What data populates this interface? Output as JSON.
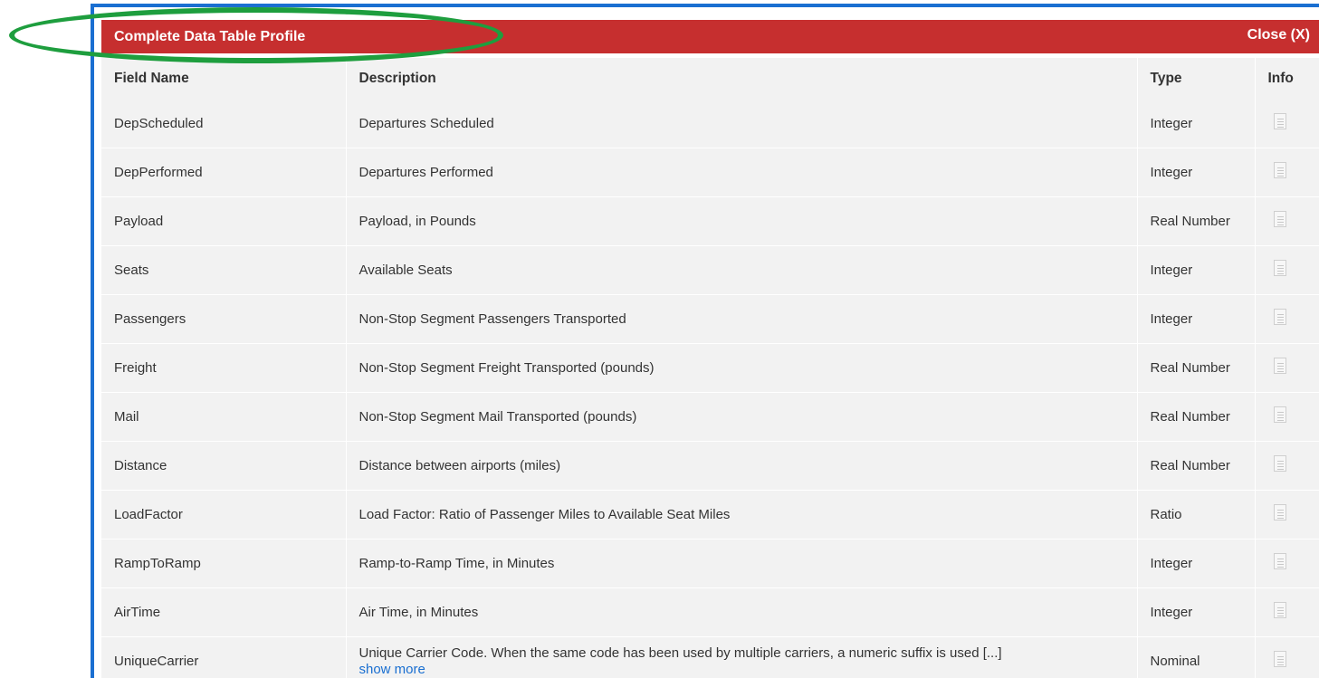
{
  "dialog": {
    "title": "Complete Data Table Profile",
    "close_label": "Close (X)"
  },
  "table": {
    "headers": {
      "field_name": "Field Name",
      "description": "Description",
      "type": "Type",
      "info": "Info"
    },
    "rows": [
      {
        "field": "DepScheduled",
        "description": "Departures Scheduled",
        "type": "Integer"
      },
      {
        "field": "DepPerformed",
        "description": "Departures Performed",
        "type": "Integer"
      },
      {
        "field": "Payload",
        "description": "Payload, in Pounds",
        "type": "Real Number"
      },
      {
        "field": "Seats",
        "description": "Available Seats",
        "type": "Integer"
      },
      {
        "field": "Passengers",
        "description": "Non-Stop Segment Passengers Transported",
        "type": "Integer"
      },
      {
        "field": "Freight",
        "description": "Non-Stop Segment Freight Transported (pounds)",
        "type": "Real Number"
      },
      {
        "field": "Mail",
        "description": "Non-Stop Segment Mail Transported (pounds)",
        "type": "Real Number"
      },
      {
        "field": "Distance",
        "description": "Distance between airports (miles)",
        "type": "Real Number"
      },
      {
        "field": "LoadFactor",
        "description": "Load Factor: Ratio of Passenger Miles to Available Seat Miles",
        "type": "Ratio"
      },
      {
        "field": "RampToRamp",
        "description": "Ramp-to-Ramp Time, in Minutes",
        "type": "Integer"
      },
      {
        "field": "AirTime",
        "description": "Air Time, in Minutes",
        "type": "Integer"
      },
      {
        "field": "UniqueCarrier",
        "description": "Unique Carrier Code. When the same code has been used by multiple carriers, a numeric suffix is used [...]",
        "type": "Nominal",
        "more_label": "show more"
      }
    ]
  },
  "icons": {
    "info": "document-icon"
  },
  "colors": {
    "title_bar": "#c62f2f",
    "modal_border": "#1a6fd1",
    "annotation_ellipse": "#1e9e3e",
    "row_background": "#f2f2f2",
    "link": "#1a6fd1"
  }
}
